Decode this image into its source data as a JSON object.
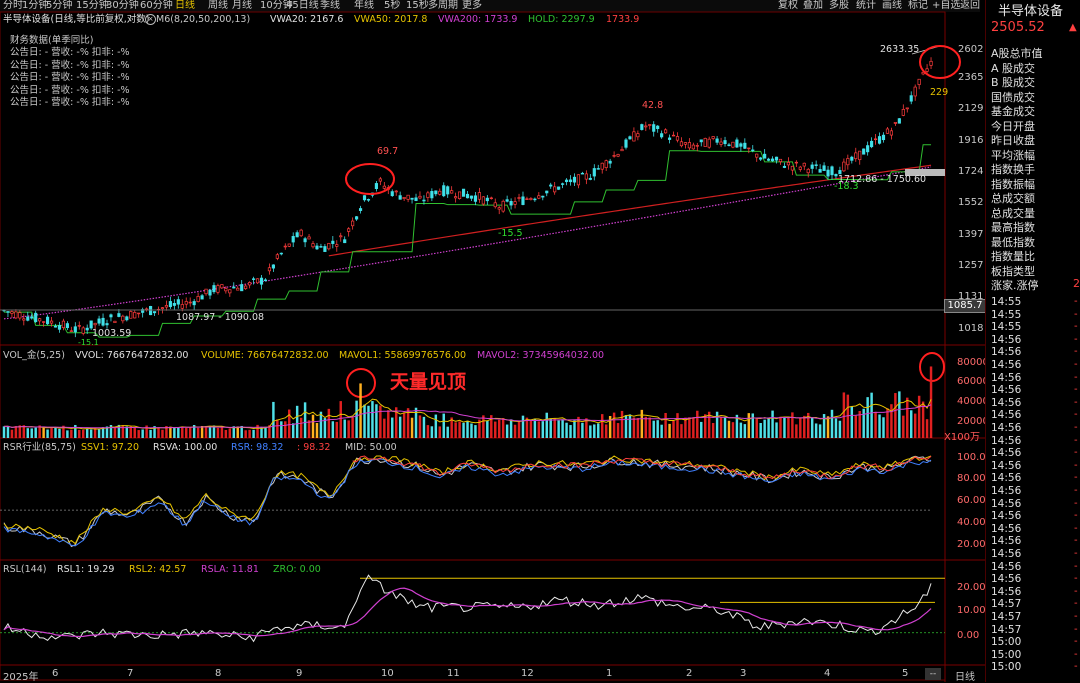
{
  "toolbar": {
    "periods": [
      "分时",
      "1分钟",
      "5分钟",
      "15分钟",
      "30分钟",
      "60分钟",
      "日线",
      "周线",
      "月线",
      "10分钟",
      "45日线",
      "季线",
      "年线",
      "5秒",
      "15秒",
      "多周期",
      "更多"
    ],
    "active_period": "日线",
    "right_buttons": [
      "复权",
      "叠加",
      "多股",
      "统计",
      "画线",
      "标记",
      "+自选",
      "返回"
    ]
  },
  "main": {
    "title": "半导体设备(日线,等比前复权,对数)",
    "indicators": [
      {
        "text": "M6(8,20,50,200,13)",
        "color": "#c8c8c8"
      },
      {
        "text": "VWA20: 2167.6",
        "color": "#e0e0e0"
      },
      {
        "text": "VWA50: 2017.8",
        "color": "#e6c300"
      },
      {
        "text": "VWA200: 1733.9",
        "color": "#d040d0"
      },
      {
        "text": "HOLD: 2297.9",
        "color": "#30c030"
      },
      {
        "text": "1733.9",
        "color": "#ff4040"
      }
    ],
    "finance_title": "财务数据(单季同比)",
    "finance_rows": [
      "公告日: -    营收: -%    扣非: -%",
      "公告日: -    营收: -%    扣非: -%",
      "公告日: -    营收: -%    扣非: -%",
      "公告日: -    营收: -%    扣非: -%",
      "公告日: -    营收: -%    扣非: -%"
    ],
    "y_labels": [
      "2602",
      "2365",
      "2129",
      "1916",
      "1724",
      "1552",
      "1397",
      "1257",
      "1131",
      "1018"
    ],
    "current_price_tag": "1085.7",
    "annotations": {
      "peak1": "69.7",
      "peak2": "42.8",
      "low1": "-15.5",
      "low2": "-18.3",
      "range1": "1087.97 - 1090.08",
      "range2": "1712.86 - 1750.60",
      "high_price": "2633.35",
      "right_num": "229",
      "low_price": "1003.59",
      "low_small": "-15.1"
    }
  },
  "volume": {
    "indicators": [
      {
        "text": "VOL_金(5,25)",
        "color": "#c8c8c8"
      },
      {
        "text": "VVOL: 76676472832.00",
        "color": "#e0e0e0"
      },
      {
        "text": "VOLUME: 76676472832.00",
        "color": "#e6c300"
      },
      {
        "text": "MAVOL1: 55869976576.00",
        "color": "#e6c300"
      },
      {
        "text": "MAVOL2: 37345964032.00",
        "color": "#d040d0"
      }
    ],
    "y_labels": [
      "80000",
      "60000",
      "40000",
      "20000"
    ],
    "unit": "X100万",
    "annotation": "天量见顶"
  },
  "rsr": {
    "indicators": [
      {
        "text": "RSR行业(85,75)",
        "color": "#c8c8c8"
      },
      {
        "text": "SSV1: 97.20",
        "color": "#e6c300"
      },
      {
        "text": "RSVA: 100.00",
        "color": "#e0e0e0"
      },
      {
        "text": "RSR: 98.32",
        "color": "#4080ff"
      },
      {
        "text": ": 98.32",
        "color": "#ff4040"
      },
      {
        "text": "MID: 50.00",
        "color": "#c8c8c8"
      }
    ],
    "y_labels": [
      "100.0",
      "80.00",
      "60.00",
      "40.00",
      "20.00"
    ]
  },
  "rsl": {
    "indicators": [
      {
        "text": "RSL(144)",
        "color": "#c8c8c8"
      },
      {
        "text": "RSL1: 19.29",
        "color": "#e0e0e0"
      },
      {
        "text": "RSL2: 42.57",
        "color": "#e6c300"
      },
      {
        "text": "RSLA: 11.81",
        "color": "#d040d0"
      },
      {
        "text": "ZRO: 0.00",
        "color": "#30c030"
      }
    ],
    "y_labels": [
      "20.00",
      "10.00",
      "0.00"
    ]
  },
  "xaxis": {
    "labels": [
      "2025年",
      "6",
      "7",
      "8",
      "9",
      "10",
      "11",
      "12",
      "1",
      "2",
      "3",
      "4",
      "5"
    ],
    "right_button": "日线",
    "scroll_button": "--"
  },
  "sidebar": {
    "title": "半导体设备",
    "price": "2505.52",
    "arrow": "▲",
    "items": [
      "A股总市值",
      "A 股成交",
      "B 股成交",
      "国债成交",
      "基金成交",
      "今日开盘",
      "昨日收盘",
      "平均涨幅",
      "指数换手",
      "指数振幅",
      "总成交额",
      "总成交量",
      "最高指数",
      "最低指数",
      "指数量比",
      "板指类型",
      "涨家.涨停"
    ],
    "tail_value": "2",
    "times": [
      "14:55",
      "14:55",
      "14:55",
      "14:56",
      "14:56",
      "14:56",
      "14:56",
      "14:56",
      "14:56",
      "14:56",
      "14:56",
      "14:56",
      "14:56",
      "14:56",
      "14:56",
      "14:56",
      "14:56",
      "14:56",
      "14:56",
      "14:56",
      "14:56",
      "14:56",
      "14:56",
      "14:56",
      "14:57",
      "14:57",
      "14:57",
      "15:00",
      "15:00",
      "15:00"
    ],
    "dash": "-"
  },
  "colors": {
    "up": "#ff3c3c",
    "down": "#40e0e8",
    "accent_yellow": "#e6c300",
    "magenta": "#d040d0",
    "green": "#30c030",
    "circle": "#ff2020"
  }
}
